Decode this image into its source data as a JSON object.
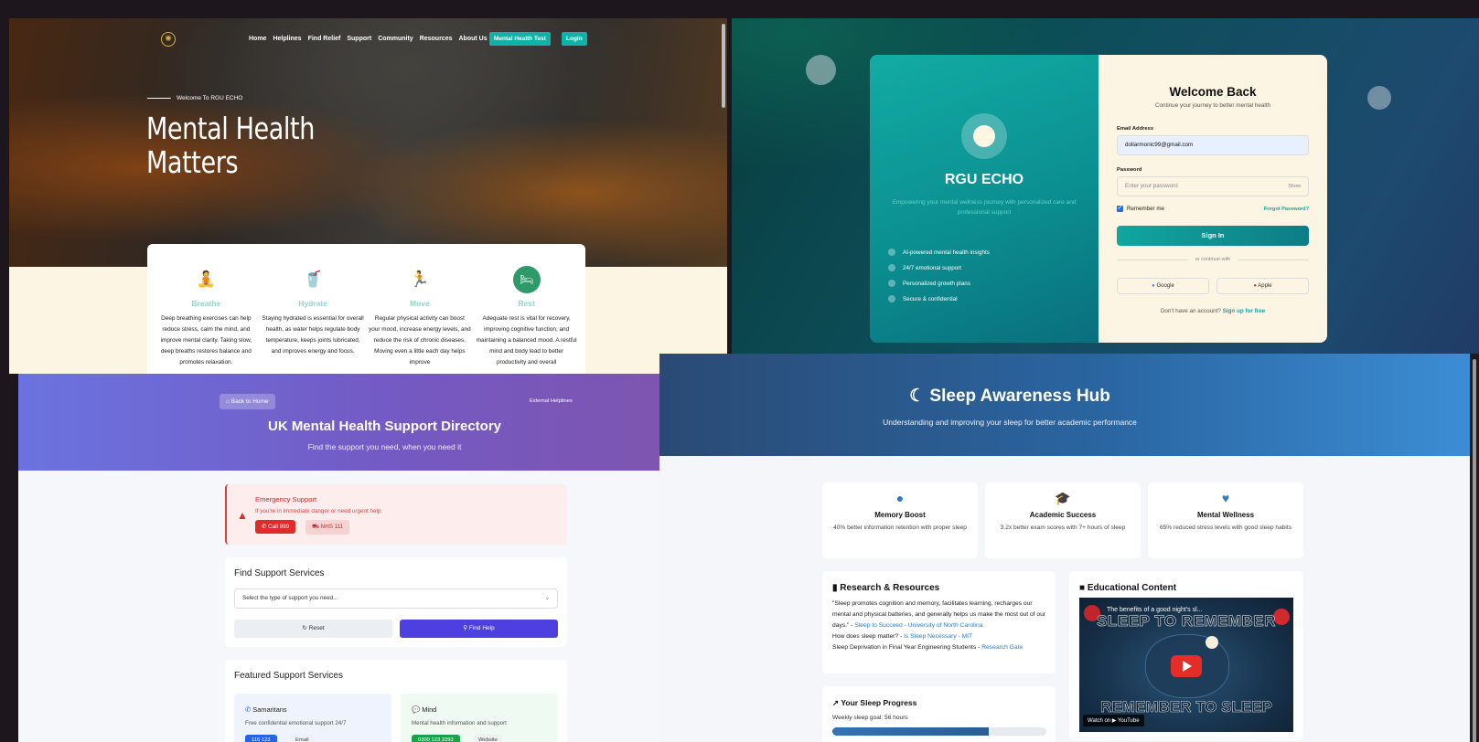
{
  "mental_health": {
    "nav": [
      "Home",
      "Helplines",
      "Find Relief",
      "Support",
      "Community",
      "Resources",
      "About Us"
    ],
    "test_button": "Mental Health Test",
    "login_button": "Login",
    "welcome": "Welcome To RGU ECHO",
    "title": "Mental Health Matters",
    "cards": [
      {
        "title": "Breathe",
        "icon": "meditation-icon",
        "text": "Deep breathing exercises can help reduce stress, calm the mind, and improve mental clarity. Taking slow, deep breaths restores balance and promotes relaxation."
      },
      {
        "title": "Hydrate",
        "icon": "drinking-icon",
        "text": "Staying hydrated is essential for overall health, as water helps regulate body temperature, keeps joints lubricated, and improves energy and focus."
      },
      {
        "title": "Move",
        "icon": "exercise-icon",
        "text": "Regular physical activity can boost your mood, increase energy levels, and reduce the risk of chronic diseases. Moving even a little each day helps improve"
      },
      {
        "title": "Rest",
        "icon": "bed-icon",
        "text": "Adequate rest is vital for recovery, improving cognitive function, and maintaining a balanced mood. A restful mind and body lead to better productivity and overall"
      }
    ]
  },
  "login": {
    "brand": "RGU ECHO",
    "tagline": "Empowering your mental wellness journey with personalized care and professional support",
    "features": [
      "AI-powered mental health insights",
      "24/7 emotional support",
      "Personalized growth plans",
      "Secure & confidential"
    ],
    "title": "Welcome Back",
    "subtitle": "Continue your journey to better mental health",
    "email_label": "Email Address",
    "email_value": "dollarmonic99@gmail.com",
    "password_label": "Password",
    "password_placeholder": "Enter your password",
    "show": "Show",
    "remember": "Remember me",
    "forgot": "Forgot Password?",
    "signin": "Sign In",
    "or": "or continue with",
    "google": "Google",
    "apple": "Apple",
    "no_account": "Don't have an account?",
    "signup": "Sign up for free"
  },
  "directory": {
    "back": "Back to Home",
    "external": "External Helplines",
    "title": "UK Mental Health Support Directory",
    "subtitle": "Find the support you need, when you need it",
    "emergency_title": "Emergency Support",
    "emergency_text": "If you're in immediate danger or need urgent help:",
    "call999": "Call 999",
    "nhs111": "NHS 111",
    "find_title": "Find Support Services",
    "select_placeholder": "Select the type of support you need...",
    "reset": "Reset",
    "find_help": "Find Help",
    "featured_title": "Featured Support Services",
    "services": [
      {
        "name": "Samaritans",
        "desc": "Free confidential emotional support 24/7",
        "phone": "116 123",
        "alt": "Email",
        "color": "#2563eb",
        "bg": "#eef3fd"
      },
      {
        "name": "Mind",
        "desc": "Mental health information and support",
        "phone": "0300 123 3393",
        "alt": "Website",
        "color": "#16a34a",
        "bg": "#eefaf2"
      }
    ]
  },
  "sleep": {
    "title": "Sleep Awareness Hub",
    "subtitle": "Understanding and improving your sleep for better academic performance",
    "stats": [
      {
        "title": "Memory Boost",
        "icon": "brain-icon",
        "text": "40% better information retention with proper sleep"
      },
      {
        "title": "Academic Success",
        "icon": "graduation-cap-icon",
        "text": "3.2x better exam scores with 7+ hours of sleep"
      },
      {
        "title": "Mental Wellness",
        "icon": "heart-icon",
        "text": "65% reduced stress levels with good sleep habits"
      }
    ],
    "research_title": "Research & Resources",
    "quote": "\"Sleep promotes cognition and memory, facilitates learning, recharges our mental and physical batteries, and generally helps us make the most out of our days.\" - ",
    "quote_link": "Sleep to Succeed - University of North Carolina",
    "q2": "How does sleep matter? - ",
    "q2_link": "Is Sleep Necessary - MIT",
    "q3": "Sleep Deprivation in Final Year Engineering Students - ",
    "q3_link": "Research Gate",
    "edu_title": "Educational Content",
    "video_title": "The benefits of a good night's sl...",
    "video_top": "SLEEP TO REMEMBER",
    "video_bottom": "REMEMBER TO SLEEP",
    "watch_on": "Watch on ▶ YouTube",
    "progress_title": "Your Sleep Progress",
    "goal": "Weekly sleep goal: 56 hours",
    "progress": 0.73
  }
}
